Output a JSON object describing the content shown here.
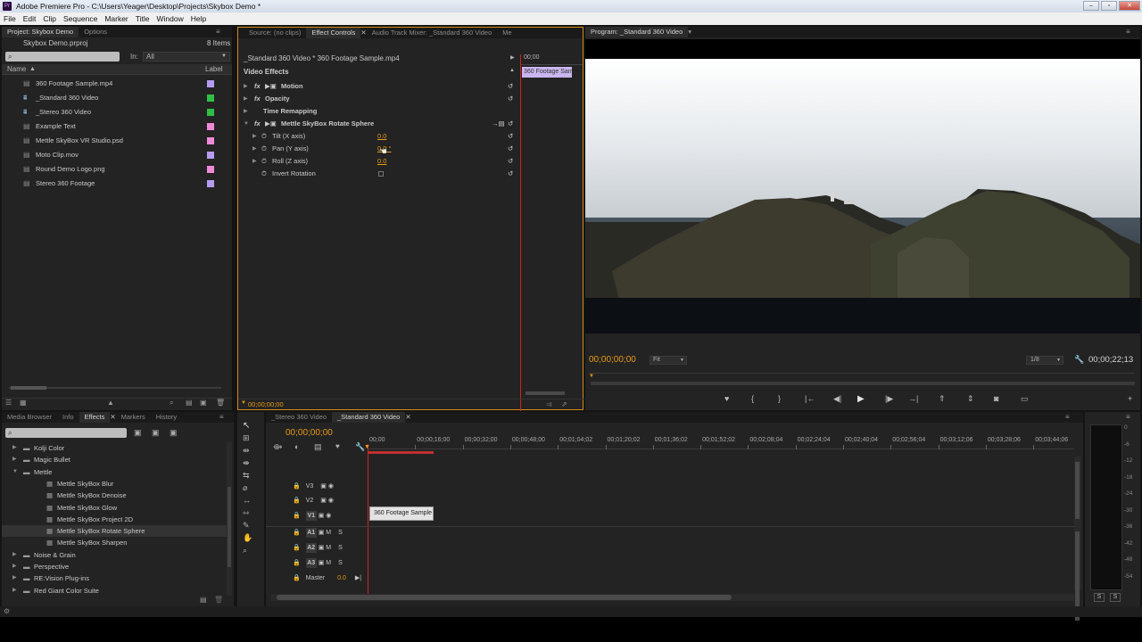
{
  "window": {
    "title": "Adobe Premiere Pro - C:\\Users\\Yeager\\Desktop\\Projects\\Skybox Demo *",
    "app_icon": "Pr"
  },
  "menu": [
    "File",
    "Edit",
    "Clip",
    "Sequence",
    "Marker",
    "Title",
    "Window",
    "Help"
  ],
  "project": {
    "tabs": [
      "Project: Skybox Demo",
      "Options"
    ],
    "project_file": "Skybox Demo.prproj",
    "item_count": "8 Items",
    "in_label": "In:",
    "in_value": "All",
    "col_name": "Name",
    "col_label": "Label",
    "items": [
      {
        "name": "360 Footage Sample.mp4",
        "color": "#b69cf0",
        "kind": "clip"
      },
      {
        "name": "_Standard 360 Video",
        "color": "#2fbf45",
        "kind": "sequence"
      },
      {
        "name": "_Stereo 360 Video",
        "color": "#2fbf45",
        "kind": "sequence"
      },
      {
        "name": "Example Text",
        "color": "#f08ad8",
        "kind": "clip"
      },
      {
        "name": "Mettle SkyBox VR Studio.psd",
        "color": "#f08ad8",
        "kind": "clip"
      },
      {
        "name": "Moto Clip.mov",
        "color": "#b69cf0",
        "kind": "clip"
      },
      {
        "name": "Round Demo Logo.png",
        "color": "#f08ad8",
        "kind": "clip"
      },
      {
        "name": "Stereo 360 Footage",
        "color": "#b69cf0",
        "kind": "clip"
      }
    ]
  },
  "effect_controls": {
    "tabs": [
      "Source: (no clips)",
      "Effect Controls",
      "Audio Track Mixer: _Standard 360 Video",
      "Me"
    ],
    "clip_path": "_Standard 360 Video * 360 Footage Sample.mp4",
    "mini_time": "00;00",
    "mini_clip": "360 Footage Sam",
    "section": "Video Effects",
    "effects": [
      "Motion",
      "Opacity",
      "Time Remapping",
      "Mettle SkyBox Rotate Sphere"
    ],
    "params": [
      {
        "name": "Tilt (X axis)",
        "value": "0.0"
      },
      {
        "name": "Pan (Y axis)",
        "value": "0.0 °"
      },
      {
        "name": "Roll (Z axis)",
        "value": "0.0"
      },
      {
        "name": "Invert Rotation",
        "value": ""
      }
    ],
    "timecode": "00;00;00;00"
  },
  "program": {
    "tab": "Program: _Standard 360 Video",
    "timecode": "00;00;00;00",
    "fit": "Fit",
    "resolution": "1/8",
    "duration": "00;00;22;13"
  },
  "effects_panel": {
    "tabs": [
      "Media Browser",
      "Info",
      "Effects",
      "Markers",
      "History"
    ],
    "items": [
      {
        "label": "Kolji Color",
        "level": 0,
        "kind": "folder"
      },
      {
        "label": "Magic Bullet",
        "level": 0,
        "kind": "folder"
      },
      {
        "label": "Mettle",
        "level": 0,
        "kind": "folder-open"
      },
      {
        "label": "Mettle SkyBox Blur",
        "level": 1,
        "kind": "effect"
      },
      {
        "label": "Mettle SkyBox Denoise",
        "level": 1,
        "kind": "effect"
      },
      {
        "label": "Mettle SkyBox Glow",
        "level": 1,
        "kind": "effect"
      },
      {
        "label": "Mettle SkyBox Project 2D",
        "level": 1,
        "kind": "effect"
      },
      {
        "label": "Mettle SkyBox Rotate Sphere",
        "level": 1,
        "kind": "effect"
      },
      {
        "label": "Mettle SkyBox Sharpen",
        "level": 1,
        "kind": "effect"
      },
      {
        "label": "Noise & Grain",
        "level": 0,
        "kind": "folder"
      },
      {
        "label": "Perspective",
        "level": 0,
        "kind": "folder"
      },
      {
        "label": "RE:Vision Plug-ins",
        "level": 0,
        "kind": "folder"
      },
      {
        "label": "Red Giant Color Suite",
        "level": 0,
        "kind": "folder"
      }
    ]
  },
  "timeline": {
    "tabs": [
      "_Stereo 360 Video",
      "_Standard 360 Video"
    ],
    "timecode": "00;00;00;00",
    "ruler": [
      "00;00",
      "00;00;16;00",
      "00;00;32;00",
      "00;00;48;00",
      "00;01;04;02",
      "00;01;20;02",
      "00;01;36;02",
      "00;01;52;02",
      "00;02;08;04",
      "00;02;24;04",
      "00;02;40;04",
      "00;02;56;04",
      "00;03;12;06",
      "00;03;28;06",
      "00;03;44;06"
    ],
    "video_tracks": [
      "V3",
      "V2",
      "V1"
    ],
    "audio_tracks": [
      "A1",
      "A2",
      "A3"
    ],
    "master": "Master",
    "master_value": "0.0",
    "clip": "360 Footage Sample",
    "mute": "M",
    "solo": "S"
  },
  "meter": {
    "scale": [
      "0",
      "-6",
      "-12",
      "-18",
      "-24",
      "-30",
      "-36",
      "-42",
      "-48",
      "-54"
    ],
    "buttons": [
      "S",
      "S"
    ]
  }
}
